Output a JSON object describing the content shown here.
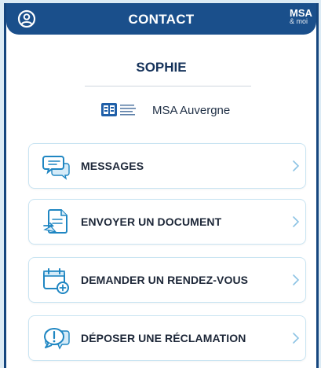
{
  "colors": {
    "header_bg": "#1a4f8b",
    "accent": "#1f86c2",
    "card_border": "#c9e4f2",
    "text_dark": "#1d2738"
  },
  "header": {
    "title": "CONTACT",
    "logo_line1": "MSA",
    "logo_line2": "& moi",
    "user_icon": "user-circle-icon"
  },
  "profile": {
    "name": "SOPHIE",
    "organization": "MSA Auvergne",
    "org_logo_icon": "msa-logo-icon"
  },
  "menu": {
    "items": [
      {
        "label": "MESSAGES",
        "icon": "chat-bubbles-icon"
      },
      {
        "label": "ENVOYER UN DOCUMENT",
        "icon": "document-send-icon"
      },
      {
        "label": "DEMANDER UN RENDEZ-VOUS",
        "icon": "calendar-add-icon"
      },
      {
        "label": "DÉPOSER UNE RÉCLAMATION",
        "icon": "complaint-bubble-icon"
      }
    ]
  }
}
